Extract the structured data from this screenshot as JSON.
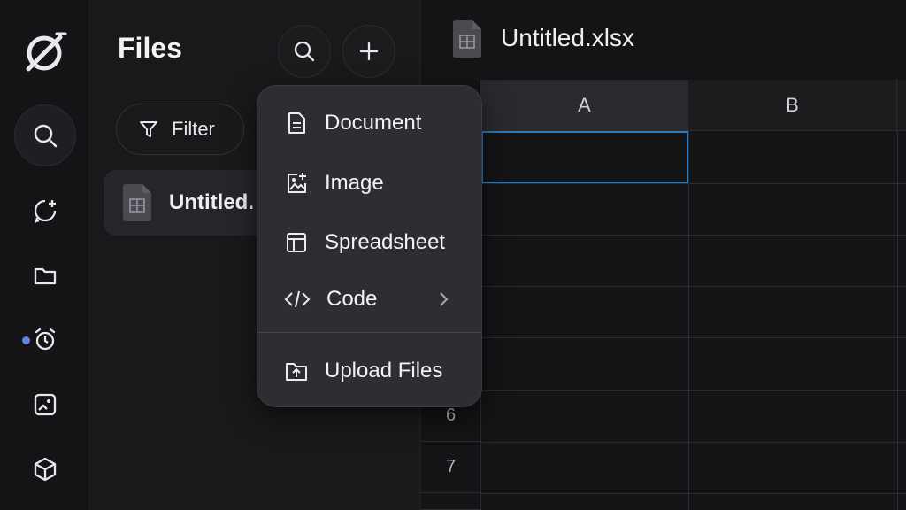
{
  "rail": {
    "items": [
      "logo",
      "search",
      "new-chat",
      "folder",
      "alarm",
      "photo-card",
      "cube"
    ]
  },
  "files_panel": {
    "title": "Files",
    "filter_label": "Filter",
    "files": [
      {
        "name": "Untitled.",
        "icon": "spreadsheet-file-icon"
      }
    ]
  },
  "new_menu": {
    "items": [
      {
        "label": "Document",
        "icon": "document-icon"
      },
      {
        "label": "Image",
        "icon": "image-add-icon"
      },
      {
        "label": "Spreadsheet",
        "icon": "table-icon"
      },
      {
        "label": "Code",
        "icon": "code-icon",
        "has_submenu": true
      },
      {
        "label": "Upload Files",
        "icon": "upload-folder-icon"
      }
    ]
  },
  "editor": {
    "tab_title": "Untitled.xlsx",
    "columns": [
      "A",
      "B"
    ],
    "row_numbers": [
      "6",
      "7"
    ]
  },
  "colors": {
    "background": "#141416",
    "panel": "#19191b",
    "menu": "#2e2e32",
    "selection": "#2b7bc4",
    "notification_dot": "#5b86e5"
  }
}
